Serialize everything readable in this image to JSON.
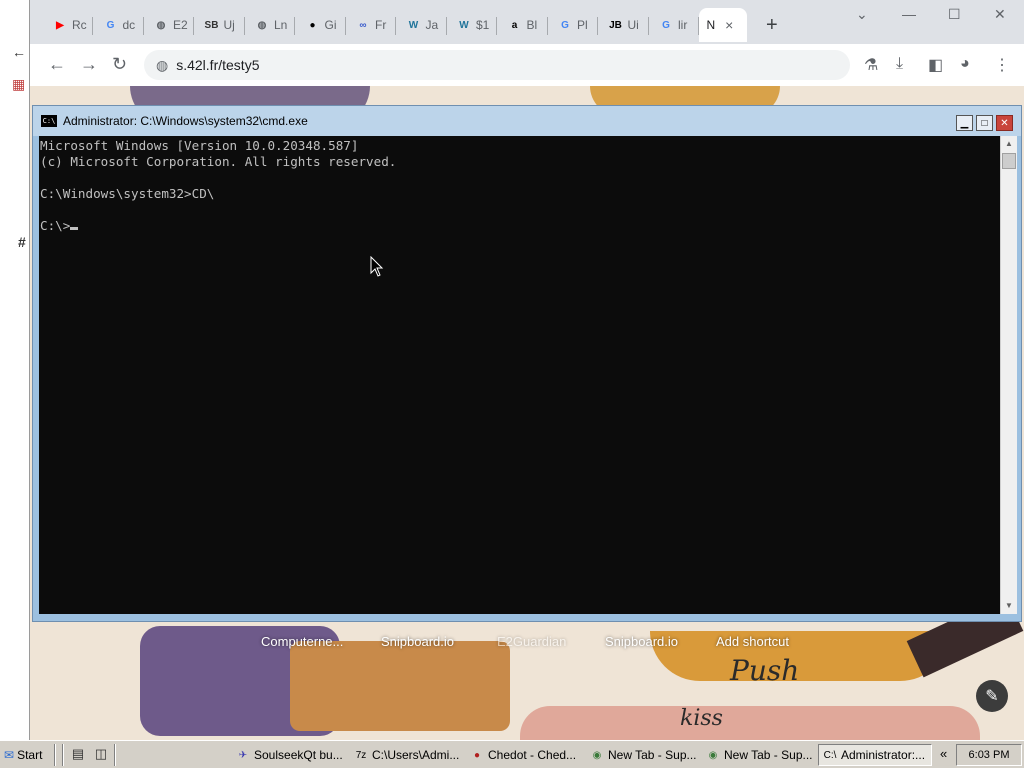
{
  "chrome": {
    "tabs": [
      {
        "label": "Rc",
        "icon": "youtube-icon",
        "color": "#ff0000",
        "glyph": "▶"
      },
      {
        "label": "dc",
        "icon": "google-icon",
        "color": "#4285f4",
        "glyph": "G"
      },
      {
        "label": "E2",
        "icon": "globe-icon",
        "color": "#5f6368",
        "glyph": "◍"
      },
      {
        "label": "Uj",
        "icon": "sb-icon",
        "color": "#333333",
        "glyph": "SB"
      },
      {
        "label": "Ln",
        "icon": "globe-icon",
        "color": "#5f6368",
        "glyph": "◍"
      },
      {
        "label": "Gi",
        "icon": "github-icon",
        "color": "#000000",
        "glyph": "●"
      },
      {
        "label": "Fr",
        "icon": "infinity-icon",
        "color": "#3a5ccc",
        "glyph": "∞"
      },
      {
        "label": "Ja",
        "icon": "wordpress-icon",
        "color": "#21759b",
        "glyph": "W"
      },
      {
        "label": "$1",
        "icon": "wordpress-icon",
        "color": "#21759b",
        "glyph": "W"
      },
      {
        "label": "Bl",
        "icon": "amazon-icon",
        "color": "#000000",
        "glyph": "a"
      },
      {
        "label": "Pl",
        "icon": "google-icon",
        "color": "#4285f4",
        "glyph": "G"
      },
      {
        "label": "Ui",
        "icon": "jb-icon",
        "color": "#000000",
        "glyph": "JB"
      },
      {
        "label": "lir",
        "icon": "google-icon",
        "color": "#4285f4",
        "glyph": "G"
      }
    ],
    "active_tab": {
      "label": "N",
      "close": "×"
    },
    "new_tab": "+",
    "url": "s.42l.fr/testy5",
    "win_controls": {
      "chevron": "⌄",
      "minimize": "—",
      "maximize": "☐",
      "close": "✕"
    }
  },
  "page": {
    "shortcuts": [
      "Computerne...",
      "Snipboard.io",
      "E2Guardian",
      "Snipboard.io",
      "Add shortcut"
    ],
    "art_text_push": "Push",
    "art_text_kiss": "kiss"
  },
  "cmd": {
    "title": "Administrator: C:\\Windows\\system32\\cmd.exe",
    "icon_text": "C:\\",
    "lines": [
      "Microsoft Windows [Version 10.0.20348.587]",
      "(c) Microsoft Corporation. All rights reserved.",
      "",
      "C:\\Windows\\system32>CD\\",
      "",
      "C:\\>"
    ]
  },
  "taskbar": {
    "start": "Start",
    "tasks": [
      {
        "label": "SoulseekQt bu...",
        "icon": "soulseek-icon",
        "glyph": "✈",
        "color": "#3b3bb0"
      },
      {
        "label": "C:\\Users\\Admi...",
        "icon": "7zip-icon",
        "glyph": "7z",
        "color": "#000000"
      },
      {
        "label": "Chedot - Ched...",
        "icon": "chedot-icon",
        "glyph": "●",
        "color": "#b02020"
      },
      {
        "label": "New Tab - Sup...",
        "icon": "browser-icon",
        "glyph": "◉",
        "color": "#3a7a3a"
      },
      {
        "label": "New Tab - Sup...",
        "icon": "browser-icon",
        "glyph": "◉",
        "color": "#3a7a3a"
      },
      {
        "label": "Administrator:...",
        "icon": "cmd-icon",
        "glyph": "C:\\",
        "color": "#000000"
      }
    ],
    "tray_arrow": "«",
    "clock": "6:03 PM"
  }
}
